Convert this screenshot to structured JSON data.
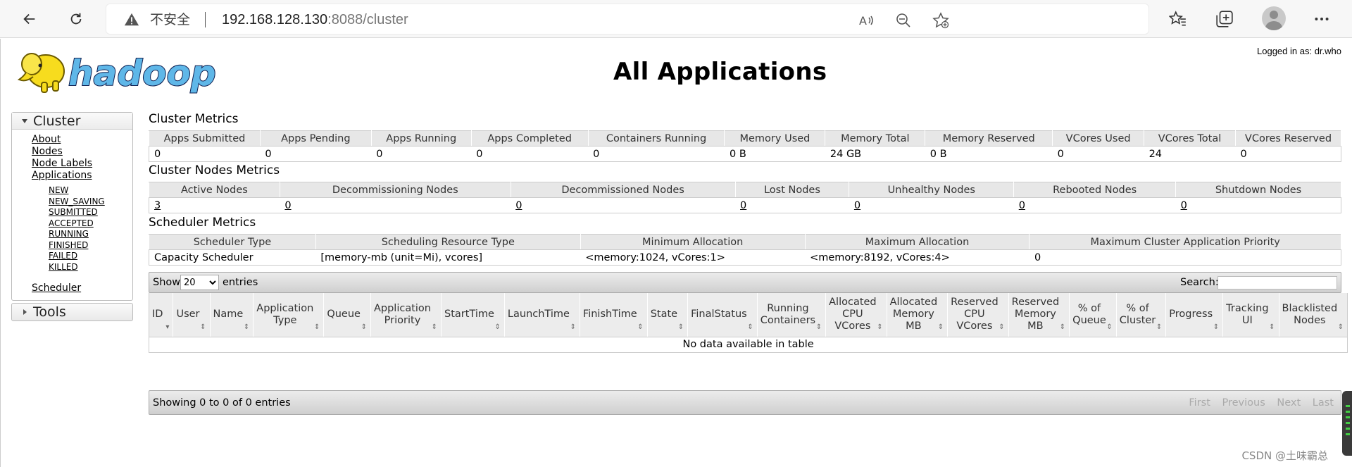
{
  "browser": {
    "insecure_label": "不安全",
    "url_host": "192.168.128.130",
    "url_rest": ":8088/cluster"
  },
  "header": {
    "logged_in": "Logged in as: dr.who",
    "title": "All Applications",
    "logo_text": "hadoop"
  },
  "sidebar": {
    "cluster_label": "Cluster",
    "links": [
      "About",
      "Nodes",
      "Node Labels",
      "Applications"
    ],
    "app_states": [
      "NEW",
      "NEW_SAVING",
      "SUBMITTED",
      "ACCEPTED",
      "RUNNING",
      "FINISHED",
      "FAILED",
      "KILLED"
    ],
    "scheduler_label": "Scheduler",
    "tools_label": "Tools"
  },
  "cluster_metrics": {
    "title": "Cluster Metrics",
    "headers": [
      "Apps Submitted",
      "Apps Pending",
      "Apps Running",
      "Apps Completed",
      "Containers Running",
      "Memory Used",
      "Memory Total",
      "Memory Reserved",
      "VCores Used",
      "VCores Total",
      "VCores Reserved"
    ],
    "values": [
      "0",
      "0",
      "0",
      "0",
      "0",
      "0 B",
      "24 GB",
      "0 B",
      "0",
      "24",
      "0"
    ]
  },
  "node_metrics": {
    "title": "Cluster Nodes Metrics",
    "headers": [
      "Active Nodes",
      "Decommissioning Nodes",
      "Decommissioned Nodes",
      "Lost Nodes",
      "Unhealthy Nodes",
      "Rebooted Nodes",
      "Shutdown Nodes"
    ],
    "values": [
      "3",
      "0",
      "0",
      "0",
      "0",
      "0",
      "0"
    ]
  },
  "scheduler_metrics": {
    "title": "Scheduler Metrics",
    "headers": [
      "Scheduler Type",
      "Scheduling Resource Type",
      "Minimum Allocation",
      "Maximum Allocation",
      "Maximum Cluster Application Priority"
    ],
    "values": [
      "Capacity Scheduler",
      "[memory-mb (unit=Mi), vcores]",
      "<memory:1024, vCores:1>",
      "<memory:8192, vCores:4>",
      "0"
    ]
  },
  "apps_table": {
    "show_label": "Show",
    "page_size": "20",
    "entries_label": "entries",
    "search_label": "Search:",
    "columns": [
      [
        "ID"
      ],
      [
        "User"
      ],
      [
        "Name"
      ],
      [
        "Application",
        "Type"
      ],
      [
        "Queue"
      ],
      [
        "Application",
        "Priority"
      ],
      [
        "StartTime"
      ],
      [
        "LaunchTime"
      ],
      [
        "FinishTime"
      ],
      [
        "State"
      ],
      [
        "FinalStatus"
      ],
      [
        "Running",
        "Containers"
      ],
      [
        "Allocated",
        "CPU",
        "VCores"
      ],
      [
        "Allocated",
        "Memory",
        "MB"
      ],
      [
        "Reserved",
        "CPU",
        "VCores"
      ],
      [
        "Reserved",
        "Memory",
        "MB"
      ],
      [
        "% of",
        "Queue"
      ],
      [
        "% of",
        "Cluster"
      ],
      [
        "Progress"
      ],
      [
        "Tracking",
        "UI"
      ],
      [
        "Blacklisted",
        "Nodes"
      ]
    ],
    "empty_text": "No data available in table",
    "info_text": "Showing 0 to 0 of 0 entries",
    "pager": [
      "First",
      "Previous",
      "Next",
      "Last"
    ]
  },
  "watermark": "CSDN @土味霸总"
}
